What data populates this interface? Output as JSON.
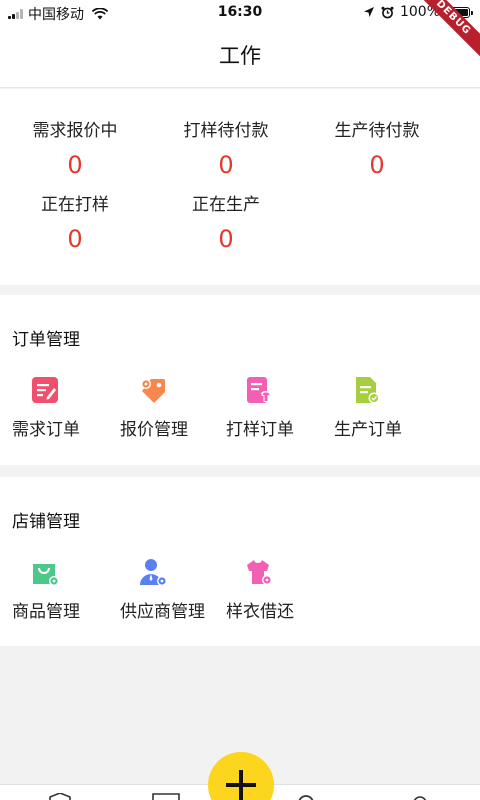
{
  "status_bar": {
    "carrier": "中国移动",
    "time": "16:30",
    "battery": "100%",
    "debug_label": "DEBUG"
  },
  "nav": {
    "title": "工作"
  },
  "stats": [
    {
      "label": "需求报价中",
      "value": "0"
    },
    {
      "label": "打样待付款",
      "value": "0"
    },
    {
      "label": "生产待付款",
      "value": "0"
    },
    {
      "label": "正在打样",
      "value": "0"
    },
    {
      "label": "正在生产",
      "value": "0"
    }
  ],
  "order_section": {
    "title": "订单管理",
    "items": [
      {
        "label": "需求订单",
        "icon": "edit-note-icon",
        "color": "#f0506e"
      },
      {
        "label": "报价管理",
        "icon": "price-tag-icon",
        "color": "#f7874f"
      },
      {
        "label": "打样订单",
        "icon": "sample-order-icon",
        "color": "#f25fb4"
      },
      {
        "label": "生产订单",
        "icon": "production-order-icon",
        "color": "#a6cf3e"
      }
    ]
  },
  "store_section": {
    "title": "店铺管理",
    "items": [
      {
        "label": "商品管理",
        "icon": "product-bag-icon",
        "color": "#4ec88a"
      },
      {
        "label": "供应商管理",
        "icon": "supplier-icon",
        "color": "#5b7ff2"
      },
      {
        "label": "样衣借还",
        "icon": "sample-shirt-icon",
        "color": "#f25fb4"
      }
    ]
  },
  "colors": {
    "accent_red": "#e23b2e",
    "fab_yellow": "#fcd51e",
    "page_bg": "#f2f2f2"
  },
  "fab": {
    "icon": "plus-icon"
  }
}
